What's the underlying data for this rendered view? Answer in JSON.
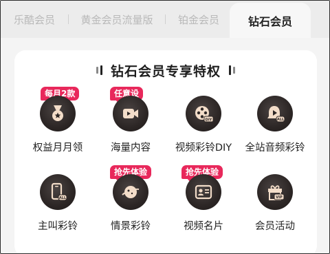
{
  "tabs": [
    {
      "label": "乐酷会员"
    },
    {
      "label": "黄金会员流量版"
    },
    {
      "label": "铂金会员"
    },
    {
      "label": "钻石会员"
    }
  ],
  "active_tab": "钻石会员",
  "card": {
    "title": "钻石会员专享特权"
  },
  "items": [
    {
      "label": "权益月月领",
      "icon": "medal-star-icon",
      "badge": "每月2款"
    },
    {
      "label": "海量内容",
      "icon": "video-camera-icon",
      "badge": "任意设"
    },
    {
      "label": "视频彩铃DIY",
      "icon": "film-reel-diy-icon",
      "badge": ""
    },
    {
      "label": "全站音频彩铃",
      "icon": "bell-play-all-icon",
      "badge": ""
    },
    {
      "label": "主叫彩铃",
      "icon": "phone-all-icon",
      "badge": ""
    },
    {
      "label": "情景彩铃",
      "icon": "planet-icon",
      "badge": "抢先体验"
    },
    {
      "label": "视频名片",
      "icon": "id-card-icon",
      "badge": "抢先体验"
    },
    {
      "label": "会员活动",
      "icon": "gift-vip-icon",
      "badge": ""
    }
  ],
  "colors": {
    "badge": "#e8285b",
    "icon_bg": "#2c2625",
    "icon_fg": "#f3ddc9"
  }
}
